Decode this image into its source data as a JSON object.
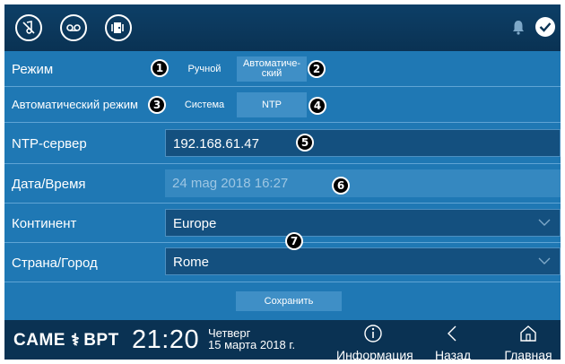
{
  "topbar": {
    "icons": [
      "mute-sound-icon",
      "voicemail-icon",
      "door-icon"
    ],
    "status_icons": [
      "bell-icon",
      "check-icon"
    ]
  },
  "mode_row": {
    "label": "Режим",
    "options": [
      "Ручной",
      "Автоматиче-ский"
    ],
    "selected_index": 1,
    "callouts": [
      "1",
      "2"
    ]
  },
  "auto_row": {
    "label": "Автоматический режим",
    "options": [
      "Система",
      "NTP"
    ],
    "selected_index": 1,
    "callouts": [
      "3",
      "4"
    ]
  },
  "ntp_row": {
    "label": "NTP-сервер",
    "value": "192.168.61.47",
    "callout": "5"
  },
  "datetime_row": {
    "label": "Дата/Время",
    "value": "24 mag 2018 16:27",
    "callout": "6"
  },
  "continent_row": {
    "label": "Континент",
    "value": "Europe"
  },
  "country_row": {
    "label": "Страна/Город",
    "value": "Rome"
  },
  "dropdowns_callout": "7",
  "save_button": "Сохранить",
  "bottombar": {
    "brand_left": "CAME",
    "brand_right": "BPT",
    "time": "21:20",
    "weekday": "Четверг",
    "date": "15 марта 2018 г.",
    "nav": [
      {
        "label": "Информация",
        "icon": "info-icon"
      },
      {
        "label": "Назад",
        "icon": "back-chevron-icon"
      },
      {
        "label": "Главная",
        "icon": "home-icon"
      }
    ]
  },
  "colors": {
    "background": "#1f78b4",
    "bar": "#0a3253",
    "selected_segment": "#3f8fc6",
    "input_field": "#14507f"
  }
}
